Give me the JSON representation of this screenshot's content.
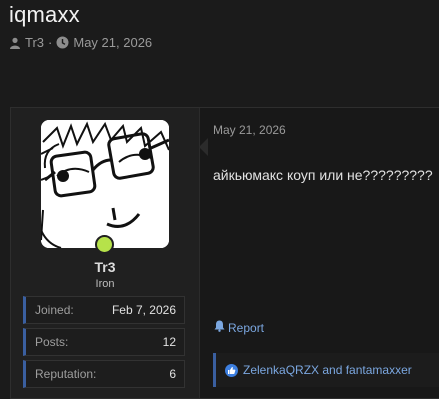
{
  "thread": {
    "title": "iqmaxx",
    "author": "Tr3",
    "separator": "·",
    "date": "May 21, 2026",
    "icons": {
      "author": "user-icon",
      "date": "clock-icon"
    }
  },
  "user": {
    "name": "Tr3",
    "rank": "Iron",
    "status_color": "#b6e24a",
    "stats": [
      {
        "label": "Joined:",
        "value": "Feb 7, 2026"
      },
      {
        "label": "Posts:",
        "value": "12"
      },
      {
        "label": "Reputation:",
        "value": "6"
      }
    ]
  },
  "post": {
    "date": "May 21, 2026",
    "body": "айкьюмакс коуп или не?????????",
    "report_label": "Report",
    "reactions_text": "ZelenkaQRZX and fantamaxxer"
  },
  "colors": {
    "background": "#1b1b1b",
    "accent": "#3a5fa0",
    "link": "#7ba7e0",
    "like": "#3d7fe0"
  }
}
